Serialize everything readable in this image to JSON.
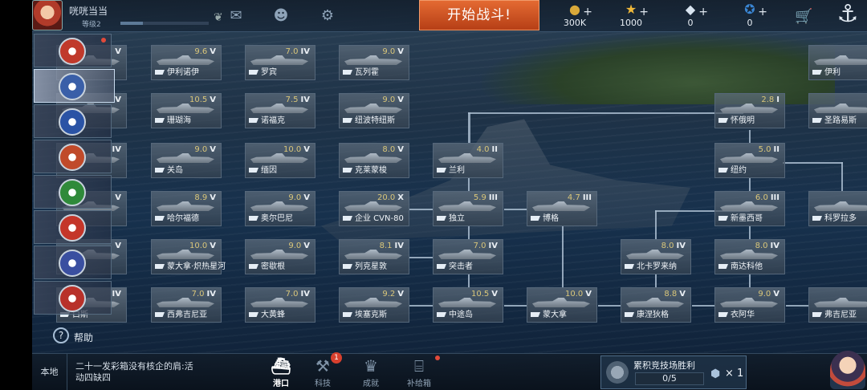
{
  "player": {
    "name": "咣咣当当",
    "level": "等级2",
    "xp_fraction": 0.25
  },
  "top_bar": {
    "start_battle": "开始战斗!",
    "resources": [
      {
        "name": "gold",
        "icon": "coin-icon",
        "value": "300K"
      },
      {
        "name": "stars",
        "icon": "star-icon",
        "value": "1000"
      },
      {
        "name": "diamonds",
        "icon": "diamond-icon",
        "value": "0"
      },
      {
        "name": "medals",
        "icon": "medal-icon",
        "value": "0"
      }
    ]
  },
  "sidebar": {
    "factions": [
      {
        "name": "faction-1",
        "color": "#c0392b",
        "active": false,
        "alert": true
      },
      {
        "name": "faction-2",
        "color": "#3a5fa8",
        "active": true,
        "alert": false
      },
      {
        "name": "faction-3",
        "color": "#2a53a5",
        "active": false,
        "alert": false
      },
      {
        "name": "faction-4",
        "color": "#c04a2a",
        "active": false,
        "alert": false
      },
      {
        "name": "faction-5",
        "color": "#2f8a3a",
        "active": false,
        "alert": false
      },
      {
        "name": "faction-6",
        "color": "#c4362a",
        "active": false,
        "alert": false
      },
      {
        "name": "faction-7",
        "color": "#3a4fa0",
        "active": false,
        "alert": false
      },
      {
        "name": "faction-8",
        "color": "#b8312a",
        "active": false,
        "alert": false
      }
    ],
    "help": "帮助"
  },
  "ships": {
    "c0": [
      {
        "tier": "",
        "grade": "V",
        "name": ""
      },
      {
        "tier": "",
        "grade": "V",
        "name": ""
      },
      {
        "tier": "",
        "grade": "IV",
        "name": ""
      },
      {
        "tier": "",
        "grade": "V",
        "name": ""
      },
      {
        "tier": "",
        "grade": "V",
        "name": ""
      },
      {
        "tier": "",
        "grade": "V",
        "name": ""
      },
      {
        "tier": "",
        "grade": "IV",
        "name": "白斯"
      }
    ],
    "c1": [
      {
        "tier": "9.6",
        "grade": "V",
        "name": "伊利诺伊"
      },
      {
        "tier": "10.5",
        "grade": "V",
        "name": "珊瑚海"
      },
      {
        "tier": "9.0",
        "grade": "V",
        "name": "关岛"
      },
      {
        "tier": "8.9",
        "grade": "V",
        "name": "哈尔福德"
      },
      {
        "tier": "10.0",
        "grade": "V",
        "name": "蒙大拿·炽热星河"
      },
      {
        "tier": "7.0",
        "grade": "IV",
        "name": "西弗吉尼亚"
      }
    ],
    "c2": [
      {
        "tier": "7.0",
        "grade": "IV",
        "name": "罗宾"
      },
      {
        "tier": "7.5",
        "grade": "IV",
        "name": "诺福克"
      },
      {
        "tier": "10.0",
        "grade": "V",
        "name": "缅因"
      },
      {
        "tier": "9.0",
        "grade": "V",
        "name": "奥尔巴尼"
      },
      {
        "tier": "9.0",
        "grade": "V",
        "name": "密歇根"
      },
      {
        "tier": "7.0",
        "grade": "IV",
        "name": "大黄蜂"
      }
    ],
    "c3": [
      {
        "tier": "9.0",
        "grade": "V",
        "name": "瓦列霍"
      },
      {
        "tier": "9.0",
        "grade": "V",
        "name": "纽波特纽斯"
      },
      {
        "tier": "8.0",
        "grade": "V",
        "name": "克莱蒙梭"
      },
      {
        "tier": "20.0",
        "grade": "X",
        "name": "企业 CVN-80"
      },
      {
        "tier": "8.1",
        "grade": "IV",
        "name": "列克星敦"
      },
      {
        "tier": "9.2",
        "grade": "V",
        "name": "埃塞克斯"
      }
    ],
    "c4": [
      {
        "tier": "4.0",
        "grade": "II",
        "name": "兰利"
      },
      {
        "tier": "5.9",
        "grade": "III",
        "name": "独立"
      },
      {
        "tier": "7.0",
        "grade": "IV",
        "name": "突击者"
      },
      {
        "tier": "10.5",
        "grade": "V",
        "name": "中途岛"
      }
    ],
    "c5": [
      {
        "tier": "4.7",
        "grade": "III",
        "name": "博格"
      },
      {
        "tier": "10.0",
        "grade": "V",
        "name": "蒙大拿"
      }
    ],
    "c6": [
      {
        "tier": "8.0",
        "grade": "IV",
        "name": "北卡罗来纳"
      },
      {
        "tier": "8.8",
        "grade": "V",
        "name": "康涅狄格"
      }
    ],
    "c7": [
      {
        "tier": "2.8",
        "grade": "I",
        "name": "怀俄明"
      },
      {
        "tier": "5.0",
        "grade": "II",
        "name": "纽约"
      },
      {
        "tier": "6.0",
        "grade": "III",
        "name": "新墨西哥"
      },
      {
        "tier": "8.0",
        "grade": "IV",
        "name": "南达科他"
      },
      {
        "tier": "9.0",
        "grade": "V",
        "name": "衣阿华"
      }
    ],
    "c8": [
      {
        "tier": "",
        "grade": "",
        "name": "伊利"
      },
      {
        "tier": "",
        "grade": "",
        "name": "圣路易斯"
      },
      {
        "tier": "",
        "grade": "",
        "name": "科罗拉多"
      },
      {
        "tier": "",
        "grade": "",
        "name": "弗吉尼亚"
      }
    ]
  },
  "bottom": {
    "local": "本地",
    "ticker": "二十一发彩箱没有核企的肩:活动四缺四",
    "tabs": [
      {
        "label": "港口",
        "icon": "harbor-icon",
        "active": true,
        "badge": ""
      },
      {
        "label": "科技",
        "icon": "tech-icon",
        "active": false,
        "badge": "1"
      },
      {
        "label": "成就",
        "icon": "achievement-icon",
        "active": false,
        "badge": ""
      },
      {
        "label": "补给箱",
        "icon": "supply-box-icon",
        "active": false,
        "badge": "dot"
      }
    ],
    "quest": {
      "title": "累积竞技场胜利",
      "progress": "0/5",
      "progress_fraction": 0.0,
      "reward_count": "× 1"
    }
  }
}
